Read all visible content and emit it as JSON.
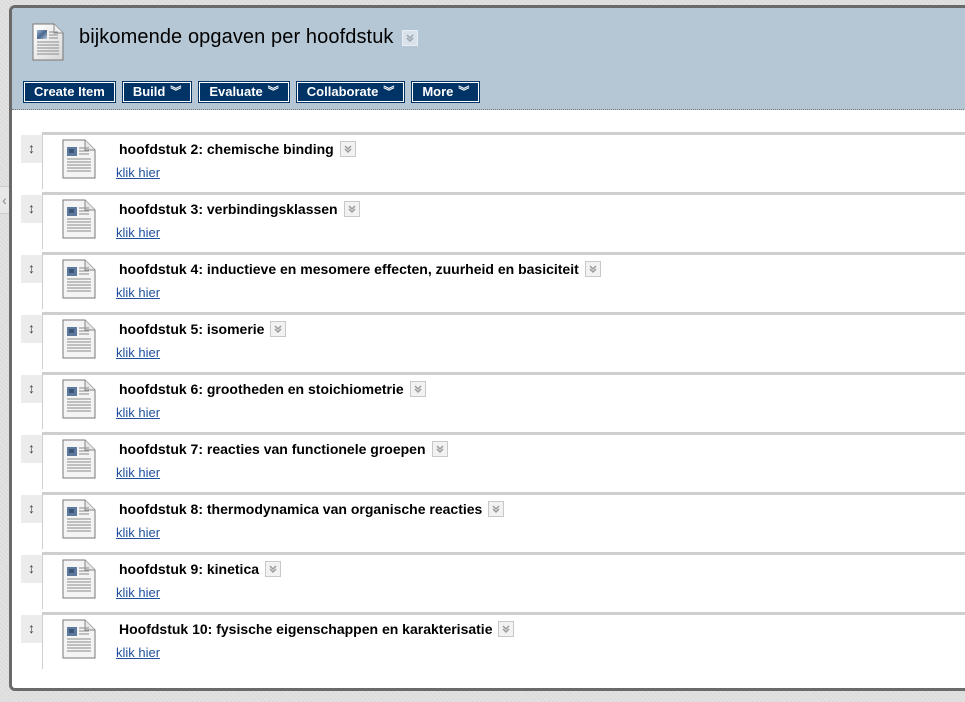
{
  "page": {
    "title": "bijkomende opgaven per hoofdstuk",
    "collapse_tab_glyph": "‹"
  },
  "toolbar": {
    "buttons": [
      {
        "label": "Create Item",
        "has_menu": false
      },
      {
        "label": "Build",
        "has_menu": true
      },
      {
        "label": "Evaluate",
        "has_menu": true
      },
      {
        "label": "Collaborate",
        "has_menu": true
      },
      {
        "label": "More",
        "has_menu": true
      }
    ],
    "menu_glyph": "︾"
  },
  "icons": {
    "drag_handle": "↕",
    "item_type": "document-icon",
    "options_menu": "double-chevron-down-icon"
  },
  "colors": {
    "header_bg": "#b5c7d5",
    "button_bg": "#003366",
    "link": "#1f4f9c",
    "frame_border": "#6a6a6a"
  },
  "items": [
    {
      "title": "hoofdstuk 2: chemische binding",
      "link": "klik hier"
    },
    {
      "title": "hoofdstuk 3: verbindingsklassen",
      "link": "klik hier"
    },
    {
      "title": "hoofdstuk 4: inductieve en mesomere effecten, zuurheid en basiciteit",
      "link": "klik hier"
    },
    {
      "title": "hoofdstuk 5: isomerie",
      "link": "klik hier"
    },
    {
      "title": "hoofdstuk 6: grootheden en stoichiometrie",
      "link": "klik hier"
    },
    {
      "title": "hoofdstuk 7: reacties van functionele groepen",
      "link": "klik hier"
    },
    {
      "title": "hoofdstuk 8: thermodynamica van organische reacties",
      "link": "klik hier"
    },
    {
      "title": "hoofdstuk 9: kinetica",
      "link": "klik hier"
    },
    {
      "title": "Hoofdstuk 10: fysische eigenschappen en karakterisatie",
      "link": "klik hier"
    }
  ]
}
